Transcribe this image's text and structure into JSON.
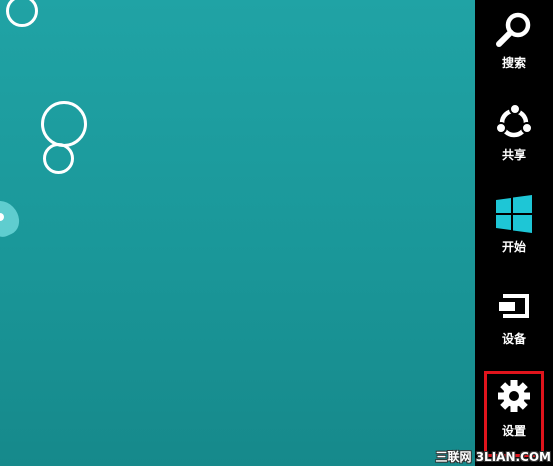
{
  "charms": {
    "search": {
      "label": "搜索",
      "icon": "search-icon"
    },
    "share": {
      "label": "共享",
      "icon": "share-icon"
    },
    "start": {
      "label": "开始",
      "icon": "windows-logo-icon",
      "color": "#1ec6d6"
    },
    "devices": {
      "label": "设备",
      "icon": "devices-icon"
    },
    "settings": {
      "label": "设置",
      "icon": "gear-icon"
    }
  },
  "colors": {
    "desktop": "#1a9a9c",
    "charm_bar": "#000000",
    "highlight": "#e0141c"
  },
  "watermark": {
    "text": "三联网 3LIAN.COM"
  }
}
